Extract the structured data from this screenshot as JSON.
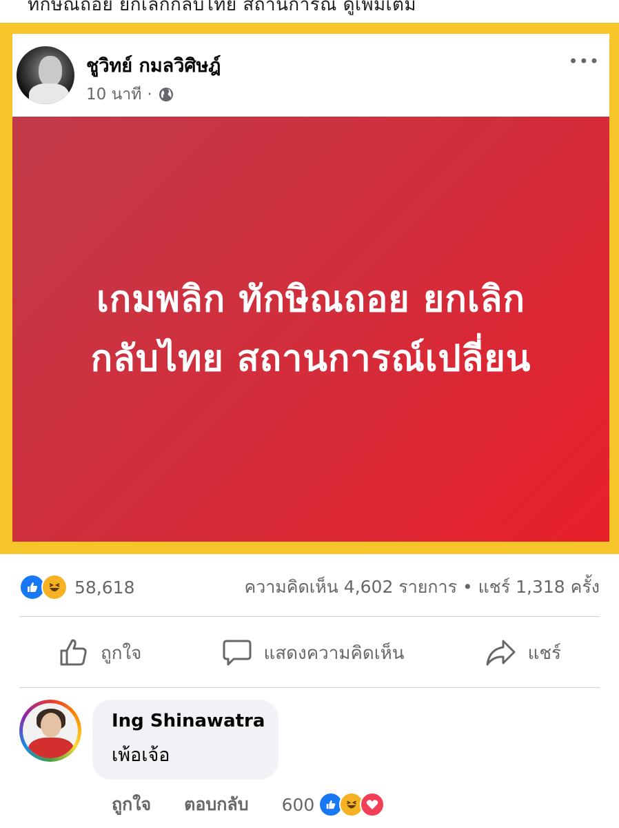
{
  "top_partial_text": "ทักษิณถอย ยกเลิกกลับไทย สถานการณ์ ดูเพิ่มเติม",
  "post": {
    "author": "ชูวิทย์ กมลวิศิษฎ์",
    "time": "10 นาที",
    "separator": "·",
    "privacy_icon": "globe-icon",
    "more_label": "•••",
    "banner_lines": [
      "เกมพลิก ทักษิณถอย ยกเลิก",
      "กลับไทย สถานการณ์เปลี่ยน"
    ]
  },
  "stats": {
    "reaction_icons": [
      "like-icon",
      "haha-icon"
    ],
    "reaction_count": "58,618",
    "comments_shares": "ความคิดเห็น 4,602 รายการ • แชร์ 1,318 ครั้ง"
  },
  "actions": {
    "like": "ถูกใจ",
    "comment": "แสดงความคิดเห็น",
    "share": "แชร์"
  },
  "comment": {
    "name": "Ing Shinawatra",
    "text": "เพ้อเจ้อ",
    "like_label": "ถูกใจ",
    "reply_label": "ตอบกลับ",
    "reaction_count": "600",
    "reaction_icons": [
      "like-icon",
      "haha-icon",
      "love-icon"
    ]
  },
  "colors": {
    "frame": "#f6c52a",
    "banner": "#d42c3a",
    "like_blue": "#1877f2",
    "haha_yellow": "#f7b125",
    "love_red": "#f33e58",
    "muted_text": "#65676b"
  }
}
